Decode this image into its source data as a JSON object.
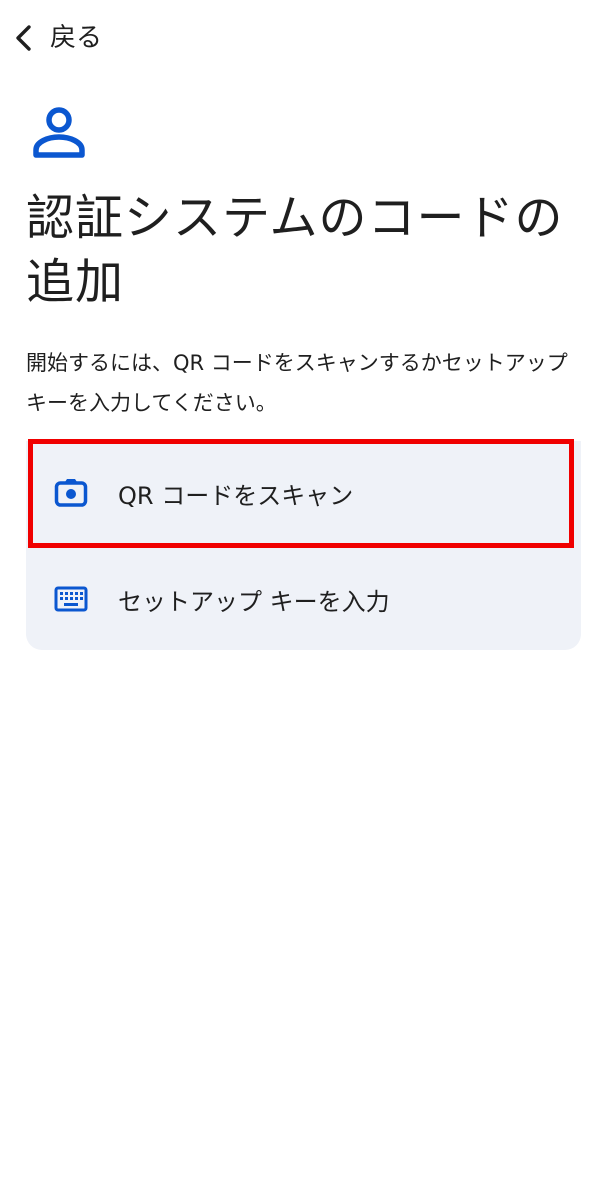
{
  "nav": {
    "back_label": "戻る"
  },
  "header": {
    "icon": "person-icon",
    "title": "認証システムのコードの追加",
    "description": "開始するには、QR コードをスキャンするかセットアップ キーを入力してください。"
  },
  "options": {
    "items": [
      {
        "label": "QR コードをスキャン",
        "icon": "camera-icon"
      },
      {
        "label": "セットアップ キーを入力",
        "icon": "keyboard-icon"
      }
    ]
  },
  "colors": {
    "accent": "#0b57d0",
    "option_background": "#eff2f8",
    "highlight": "#f00000",
    "text": "#1f1f1f"
  }
}
